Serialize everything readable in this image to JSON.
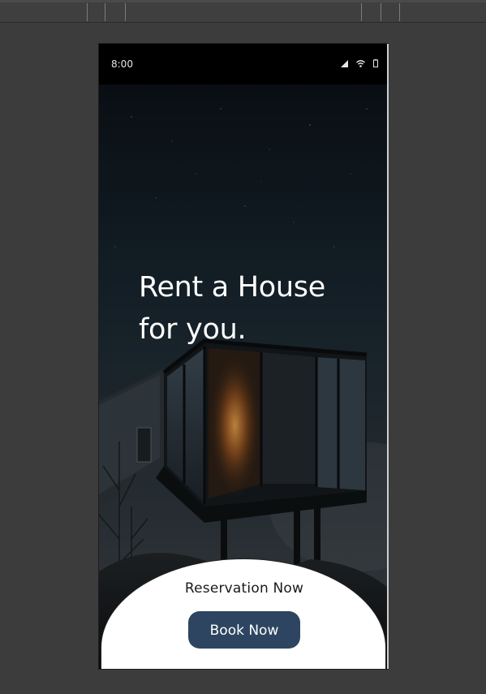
{
  "toolbar": {
    "separator_count": 8
  },
  "status_bar": {
    "time": "8:00",
    "icons": [
      "cellular-signal-icon",
      "wifi-icon",
      "battery-icon"
    ]
  },
  "hero": {
    "headline_line1": "Rent a House",
    "headline_line2": "for you.",
    "image": "modern-glass-cabin-night-sky"
  },
  "bottom_sheet": {
    "reservation_label": "Reservation Now",
    "book_button_label": "Book Now"
  },
  "colors": {
    "button": "#2d4560",
    "headline": "#ffffff",
    "background": "#3c3c3c"
  }
}
